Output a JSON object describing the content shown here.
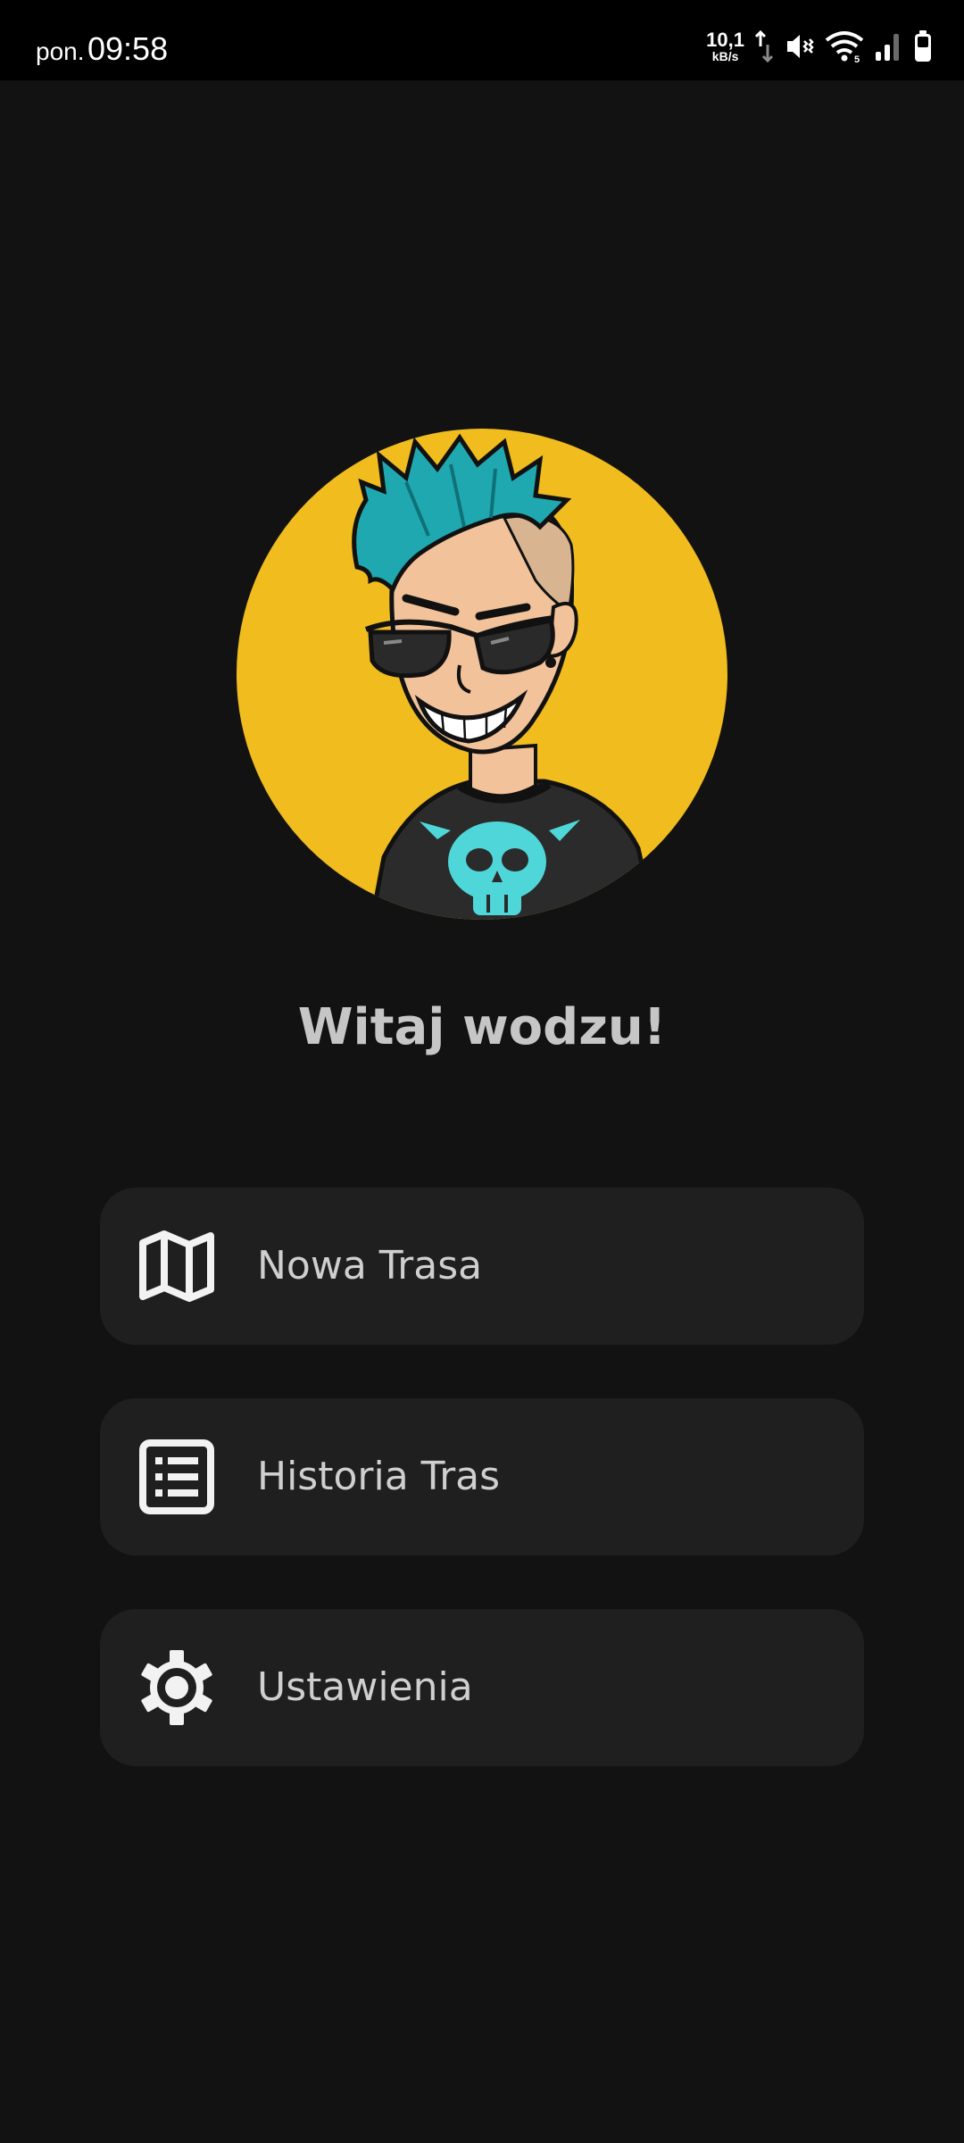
{
  "status_bar": {
    "day": "pon.",
    "time": "09:58",
    "net_speed_value": "10,1",
    "net_speed_unit": "kB/s",
    "icons": [
      "data-transfer-icon",
      "vibrate-icon",
      "wifi-icon",
      "signal-icon",
      "battery-icon"
    ]
  },
  "avatar": {
    "icon": "avatar-icon",
    "background_color": "#F0BC1E",
    "hair_color": "#1FA8B0"
  },
  "greeting": "Witaj wodzu!",
  "menu": {
    "items": [
      {
        "label": "Nowa Trasa",
        "icon": "map-icon"
      },
      {
        "label": "Historia Tras",
        "icon": "list-icon"
      },
      {
        "label": "Ustawienia",
        "icon": "gear-icon"
      }
    ]
  },
  "colors": {
    "background": "#121212",
    "card": "#1F1F1F",
    "text": "#CFCFCF"
  }
}
